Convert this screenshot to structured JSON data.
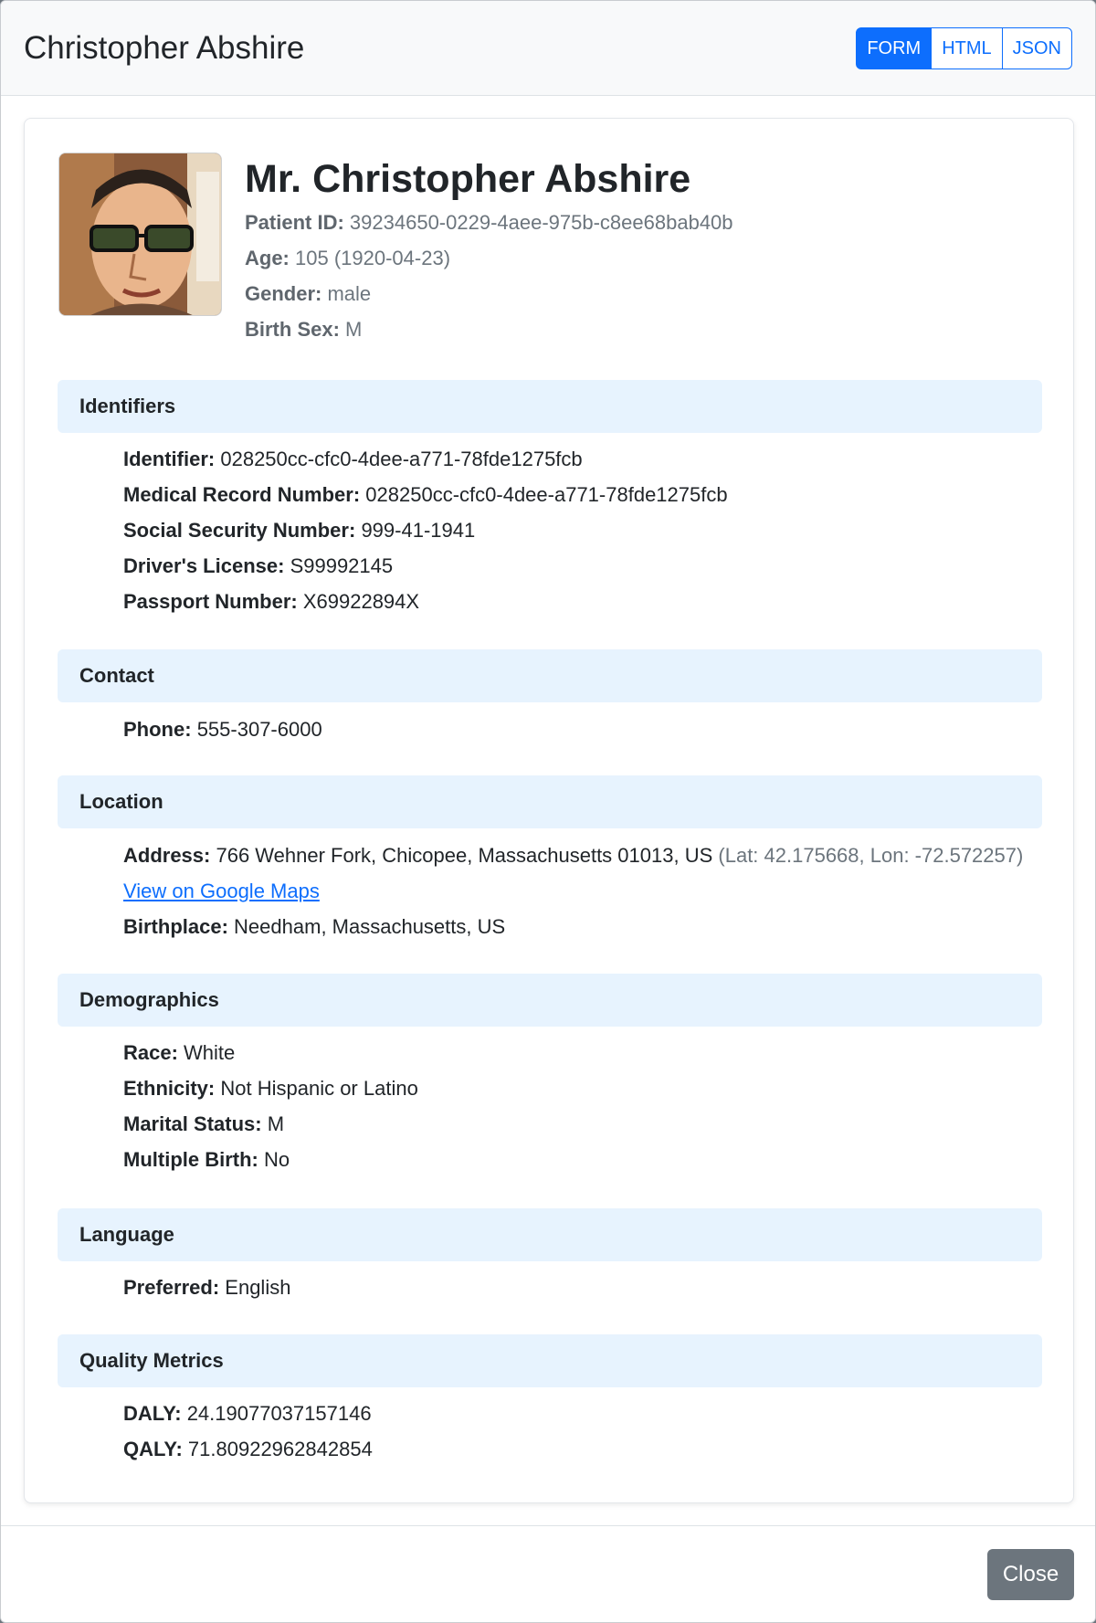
{
  "modal": {
    "title": "Christopher Abshire",
    "view_tabs": [
      "FORM",
      "HTML",
      "JSON"
    ],
    "active_tab": "FORM",
    "close_label": "Close"
  },
  "patient": {
    "avatar_icon": "patient-photo",
    "full_name": "Mr. Christopher Abshire",
    "patient_id_label": "Patient ID:",
    "patient_id": "39234650-0229-4aee-975b-c8ee68bab40b",
    "age_label": "Age:",
    "age": "105 (1920-04-23)",
    "gender_label": "Gender:",
    "gender": "male",
    "birth_sex_label": "Birth Sex:",
    "birth_sex": "M"
  },
  "sections": {
    "identifiers": {
      "title": "Identifiers",
      "rows": [
        {
          "label": "Identifier:",
          "value": "028250cc-cfc0-4dee-a771-78fde1275fcb"
        },
        {
          "label": "Medical Record Number:",
          "value": "028250cc-cfc0-4dee-a771-78fde1275fcb"
        },
        {
          "label": "Social Security Number:",
          "value": "999-41-1941"
        },
        {
          "label": "Driver's License:",
          "value": "S99992145"
        },
        {
          "label": "Passport Number:",
          "value": "X69922894X"
        }
      ]
    },
    "contact": {
      "title": "Contact",
      "rows": [
        {
          "label": "Phone:",
          "value": "555-307-6000"
        }
      ]
    },
    "location": {
      "title": "Location",
      "address_label": "Address:",
      "address": "766 Wehner Fork, Chicopee, Massachusetts 01013, US",
      "coords": "(Lat: 42.175668, Lon: -72.572257)",
      "maps_link": "View on Google Maps",
      "birthplace_label": "Birthplace:",
      "birthplace": "Needham, Massachusetts, US"
    },
    "demographics": {
      "title": "Demographics",
      "rows": [
        {
          "label": "Race:",
          "value": "White"
        },
        {
          "label": "Ethnicity:",
          "value": "Not Hispanic or Latino"
        },
        {
          "label": "Marital Status:",
          "value": "M"
        },
        {
          "label": "Multiple Birth:",
          "value": "No"
        }
      ]
    },
    "language": {
      "title": "Language",
      "rows": [
        {
          "label": "Preferred:",
          "value": "English"
        }
      ]
    },
    "quality": {
      "title": "Quality Metrics",
      "rows": [
        {
          "label": "DALY:",
          "value": "24.19077037157146"
        },
        {
          "label": "QALY:",
          "value": "71.80922962842854"
        }
      ]
    }
  },
  "colors": {
    "primary": "#0d6efd",
    "section_bg": "#e7f3fe",
    "secondary_button": "#6c757d"
  }
}
